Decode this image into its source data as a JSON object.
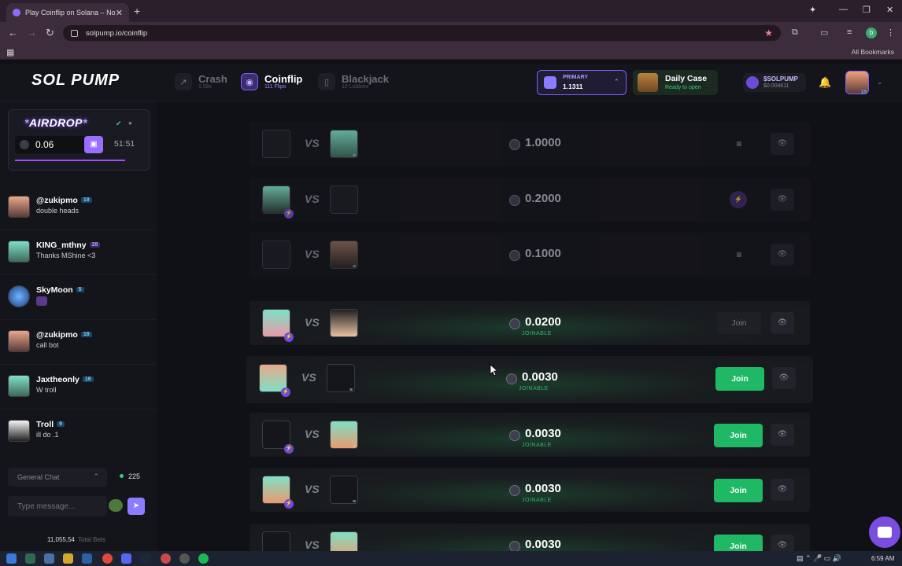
{
  "browser": {
    "tab_title": "Play Coinflip on Solana – No K",
    "url": "solpump.io/coinflip",
    "all_bookmarks": "All Bookmarks",
    "profile_letter": "b"
  },
  "header": {
    "logo": "SOL PUMP",
    "games": [
      {
        "name": "Crash",
        "sub": "1.58x"
      },
      {
        "name": "Coinflip",
        "sub": "111 Flips"
      },
      {
        "name": "Blackjack",
        "sub": "10 Lobbies"
      }
    ],
    "primary_label": "PRIMARY",
    "primary_value": "1.1311",
    "daily_title": "Daily Case",
    "daily_sub": "Ready to open",
    "token_name": "$SOLPUMP",
    "token_value": "$0.004611",
    "user_level": "18"
  },
  "airdrop": {
    "title": "AIRDROP",
    "amount": "0.06",
    "timer": "51:51"
  },
  "chat": {
    "messages": [
      {
        "user": "@zukipmo",
        "level": "18",
        "text": "double heads"
      },
      {
        "user": "KING_mthny",
        "level": "28",
        "text": "Thanks MShine <3"
      },
      {
        "user": "SkyMoon",
        "level": "5",
        "text": ""
      },
      {
        "user": "@zukipmo",
        "level": "18",
        "text": "call bot"
      },
      {
        "user": "Jaxtheonly",
        "level": "16",
        "text": "W troll"
      },
      {
        "user": "Troll",
        "level": "9",
        "text": "ill do .1"
      }
    ],
    "channel": "General Chat",
    "online_count": "225",
    "input_placeholder": "Type message...",
    "total_bets_value": "11,055,54",
    "total_bets_label": "Total Bets"
  },
  "flips": [
    {
      "amount": "1.0000",
      "status": "",
      "action": "≡"
    },
    {
      "amount": "0.2000",
      "status": "",
      "action": "⚡"
    },
    {
      "amount": "0.1000",
      "status": "",
      "action": "≡"
    },
    {
      "amount": "0.0200",
      "status": "JOINABLE",
      "action": "Join"
    },
    {
      "amount": "0.0030",
      "status": "JOINABLE",
      "action": "Join"
    },
    {
      "amount": "0.0030",
      "status": "JOINABLE",
      "action": "Join"
    },
    {
      "amount": "0.0030",
      "status": "JOINABLE",
      "action": "Join"
    },
    {
      "amount": "0.0030",
      "status": "",
      "action": "Join"
    }
  ],
  "taskbar": {
    "time": "6:59 AM"
  }
}
